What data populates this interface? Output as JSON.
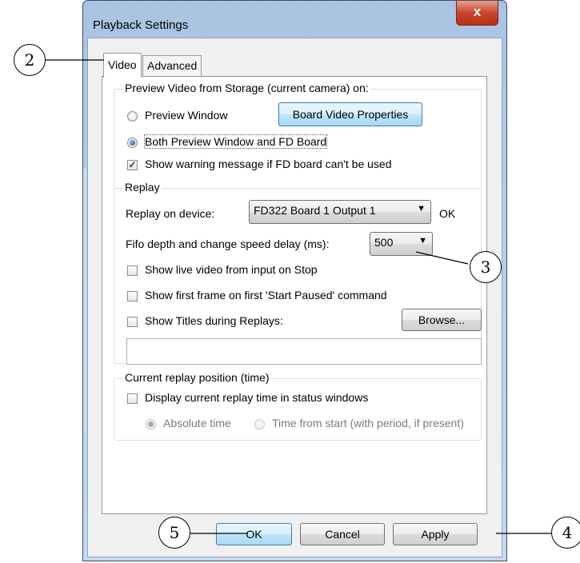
{
  "window": {
    "title": "Playback Settings",
    "close_label": "x"
  },
  "tabs": [
    {
      "label": "Video",
      "active": true
    },
    {
      "label": "Advanced",
      "active": false
    }
  ],
  "preview_group": {
    "label": "Preview Video from Storage (current camera) on:",
    "radio_preview_window": "Preview Window",
    "radio_preview_window_checked": false,
    "board_properties_button": "Board Video Properties",
    "radio_both": "Both Preview Window and FD Board",
    "radio_both_checked": true,
    "show_warning": "Show warning message if FD board can't be used",
    "show_warning_checked": true
  },
  "replay_group": {
    "label": "Replay",
    "device_label": "Replay on device:",
    "device_value": "FD322 Board 1 Output 1",
    "device_status": "OK",
    "fifo_label": "Fifo depth and change speed delay (ms):",
    "fifo_value": "500",
    "live_video": "Show live video from input on Stop",
    "first_frame": "Show first frame on first 'Start Paused' command",
    "show_titles": "Show Titles during Replays:",
    "browse_button": "Browse...",
    "titles_path": ""
  },
  "position_group": {
    "label": "Current replay position (time)",
    "display_time": "Display current replay time in status windows",
    "absolute_time": "Absolute time",
    "absolute_time_checked": true,
    "time_from_start": "Time from start (with period, if present)"
  },
  "buttons": {
    "ok": "OK",
    "cancel": "Cancel",
    "apply": "Apply"
  },
  "callouts": {
    "c2": "2",
    "c3": "3",
    "c4": "4",
    "c5": "5"
  },
  "colors": {
    "window_frame": "#a9c3e2",
    "close_button": "#c9462c",
    "focus_border": "#3c7fb1"
  }
}
